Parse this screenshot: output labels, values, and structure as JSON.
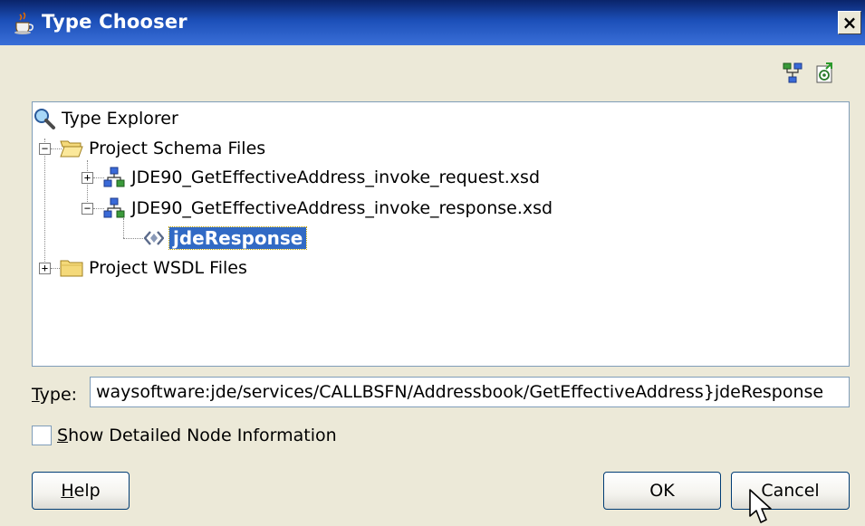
{
  "window": {
    "title": "Type Chooser",
    "close_glyph": "×"
  },
  "toolbar": {
    "icons": [
      "hierarchy-view-icon",
      "web-service-icon"
    ]
  },
  "tree": {
    "root_label": "Type Explorer",
    "nodes": [
      {
        "label": "Project Schema Files",
        "expanded": true,
        "icon": "folder-open-icon"
      },
      {
        "label": "JDE90_GetEffectiveAddress_invoke_request.xsd",
        "expanded": false,
        "icon": "schema-icon"
      },
      {
        "label": "JDE90_GetEffectiveAddress_invoke_response.xsd",
        "expanded": true,
        "icon": "schema-icon"
      },
      {
        "label": "jdeResponse",
        "selected": true,
        "icon": "element-icon"
      },
      {
        "label": "Project WSDL Files",
        "expanded": false,
        "icon": "folder-closed-icon"
      }
    ],
    "expand_glyph": "+",
    "collapse_glyph": "−"
  },
  "type_field": {
    "label": "Type:",
    "value": "waysoftware:jde/services/CALLBSFN/Addressbook/GetEffectiveAddress}jdeResponse"
  },
  "options": {
    "show_detailed_label": "Show Detailed Node Information",
    "checked": false
  },
  "buttons": {
    "help": "Help",
    "ok": "OK",
    "cancel": "Cancel"
  },
  "colors": {
    "title_bar": "#0a246a",
    "selection": "#316ac5",
    "dialog_bg": "#ece9d8"
  }
}
